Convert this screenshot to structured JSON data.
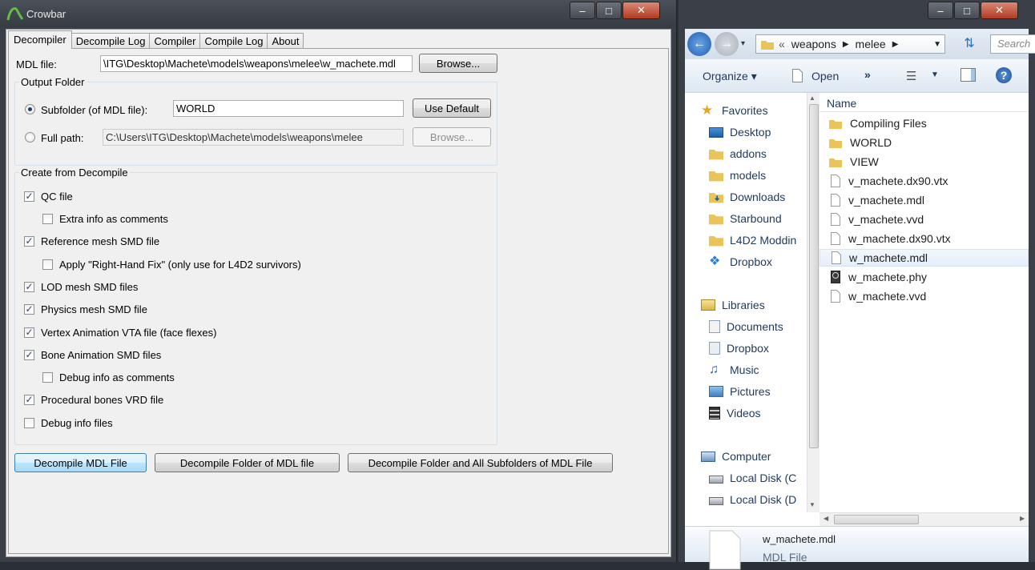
{
  "crowbar": {
    "title": "Crowbar",
    "controls": {
      "minimize": "–",
      "maximize": "□",
      "close": "✕"
    },
    "tabs": [
      "Decompiler",
      "Decompile Log",
      "Compiler",
      "Compile Log",
      "About"
    ],
    "mdl_file_label": "MDL file:",
    "mdl_file_value": "\\ITG\\Desktop\\Machete\\models\\weapons\\melee\\w_machete.mdl",
    "browse_label": "Browse...",
    "output_folder": {
      "legend": "Output Folder",
      "subfolder_label": "Subfolder (of MDL file):",
      "subfolder_value": "WORLD",
      "use_default_label": "Use Default",
      "fullpath_label": "Full path:",
      "fullpath_value": "C:\\Users\\ITG\\Desktop\\Machete\\models\\weapons\\melee",
      "fullpath_browse_label": "Browse..."
    },
    "create_from": {
      "legend": "Create from Decompile",
      "options": [
        {
          "label": "QC file",
          "checked": true
        },
        {
          "label": "Extra info as comments",
          "checked": false
        },
        {
          "label": "Reference mesh SMD file",
          "checked": true
        },
        {
          "label": "Apply \"Right-Hand Fix\" (only use for L4D2 survivors)",
          "checked": false
        },
        {
          "label": "LOD mesh SMD files",
          "checked": true
        },
        {
          "label": "Physics mesh SMD file",
          "checked": true
        },
        {
          "label": "Vertex Animation VTA file (face flexes)",
          "checked": true
        },
        {
          "label": "Bone Animation SMD files",
          "checked": true
        },
        {
          "label": "Debug info as comments",
          "checked": false
        },
        {
          "label": "Procedural bones VRD file",
          "checked": true
        },
        {
          "label": "Debug info files",
          "checked": false
        }
      ]
    },
    "actions": {
      "decompile_file": "Decompile MDL File",
      "decompile_folder": "Decompile Folder of MDL file",
      "decompile_all": "Decompile Folder and All Subfolders of MDL File"
    }
  },
  "explorer": {
    "controls": {
      "minimize": "–",
      "maximize": "□",
      "close": "✕"
    },
    "breadcrumb": [
      "«",
      "weapons",
      "melee"
    ],
    "search_placeholder": "Search",
    "toolbar": {
      "organize": "Organize ▾",
      "open": "Open",
      "more": "»"
    },
    "nav": {
      "favorites": "Favorites",
      "fav_items": [
        "Desktop",
        "addons",
        "models",
        "Downloads",
        "Starbound",
        "L4D2 Moddin",
        "Dropbox"
      ],
      "libraries": "Libraries",
      "lib_items": [
        "Documents",
        "Dropbox",
        "Music",
        "Pictures",
        "Videos"
      ],
      "computer": "Computer",
      "comp_items": [
        "Local Disk (C",
        "Local Disk (D"
      ]
    },
    "column_name": "Name",
    "files": [
      {
        "name": "Compiling Files",
        "type": "folder"
      },
      {
        "name": "WORLD",
        "type": "folder"
      },
      {
        "name": "VIEW",
        "type": "folder"
      },
      {
        "name": "v_machete.dx90.vtx",
        "type": "file"
      },
      {
        "name": "v_machete.mdl",
        "type": "file"
      },
      {
        "name": "v_machete.vvd",
        "type": "file"
      },
      {
        "name": "w_machete.dx90.vtx",
        "type": "file"
      },
      {
        "name": "w_machete.mdl",
        "type": "file",
        "selected": true
      },
      {
        "name": "w_machete.phy",
        "type": "phy"
      },
      {
        "name": "w_machete.vvd",
        "type": "file"
      }
    ],
    "details": {
      "name": "w_machete.mdl",
      "type": "MDL File"
    }
  }
}
